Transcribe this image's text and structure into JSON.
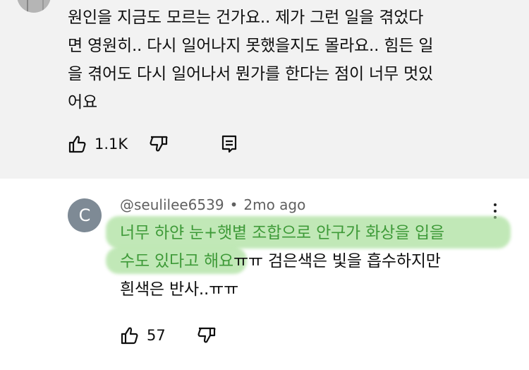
{
  "top_comment": {
    "lines": [
      "원인을 지금도 모르는 건가요.. 제가 그런 일을 겪었다",
      "면 영원히.. 다시 일어나지 못했을지도 몰라요.. 힘든 일",
      "을 겪어도 다시 일어나서 뭔가를 한다는 점이 너무 멋있",
      "어요"
    ],
    "like_count": "1.1K"
  },
  "reply": {
    "avatar_letter": "C",
    "author": "@seulilee6539",
    "separator": "•",
    "time": "2mo ago",
    "text_highlight_1": "너무 하얀 눈+햇볕 조합으로 안구가 화상을 입을",
    "text_highlight_2": "수도 있다고 해요",
    "text_rest_2": "ㅠㅠ 검은색은 빛을 흡수하지만",
    "text_line_3": "흰색은 반사..ㅠㅠ",
    "like_count": "57"
  },
  "colors": {
    "top_bg": "#f2f2f2",
    "highlight": "#a8df9a",
    "highlight_text": "#3e9a38",
    "avatar_c": "#7e8a95",
    "meta_text": "#606060"
  },
  "icons": [
    "like-icon",
    "dislike-icon",
    "reply-icon",
    "more-icon"
  ]
}
